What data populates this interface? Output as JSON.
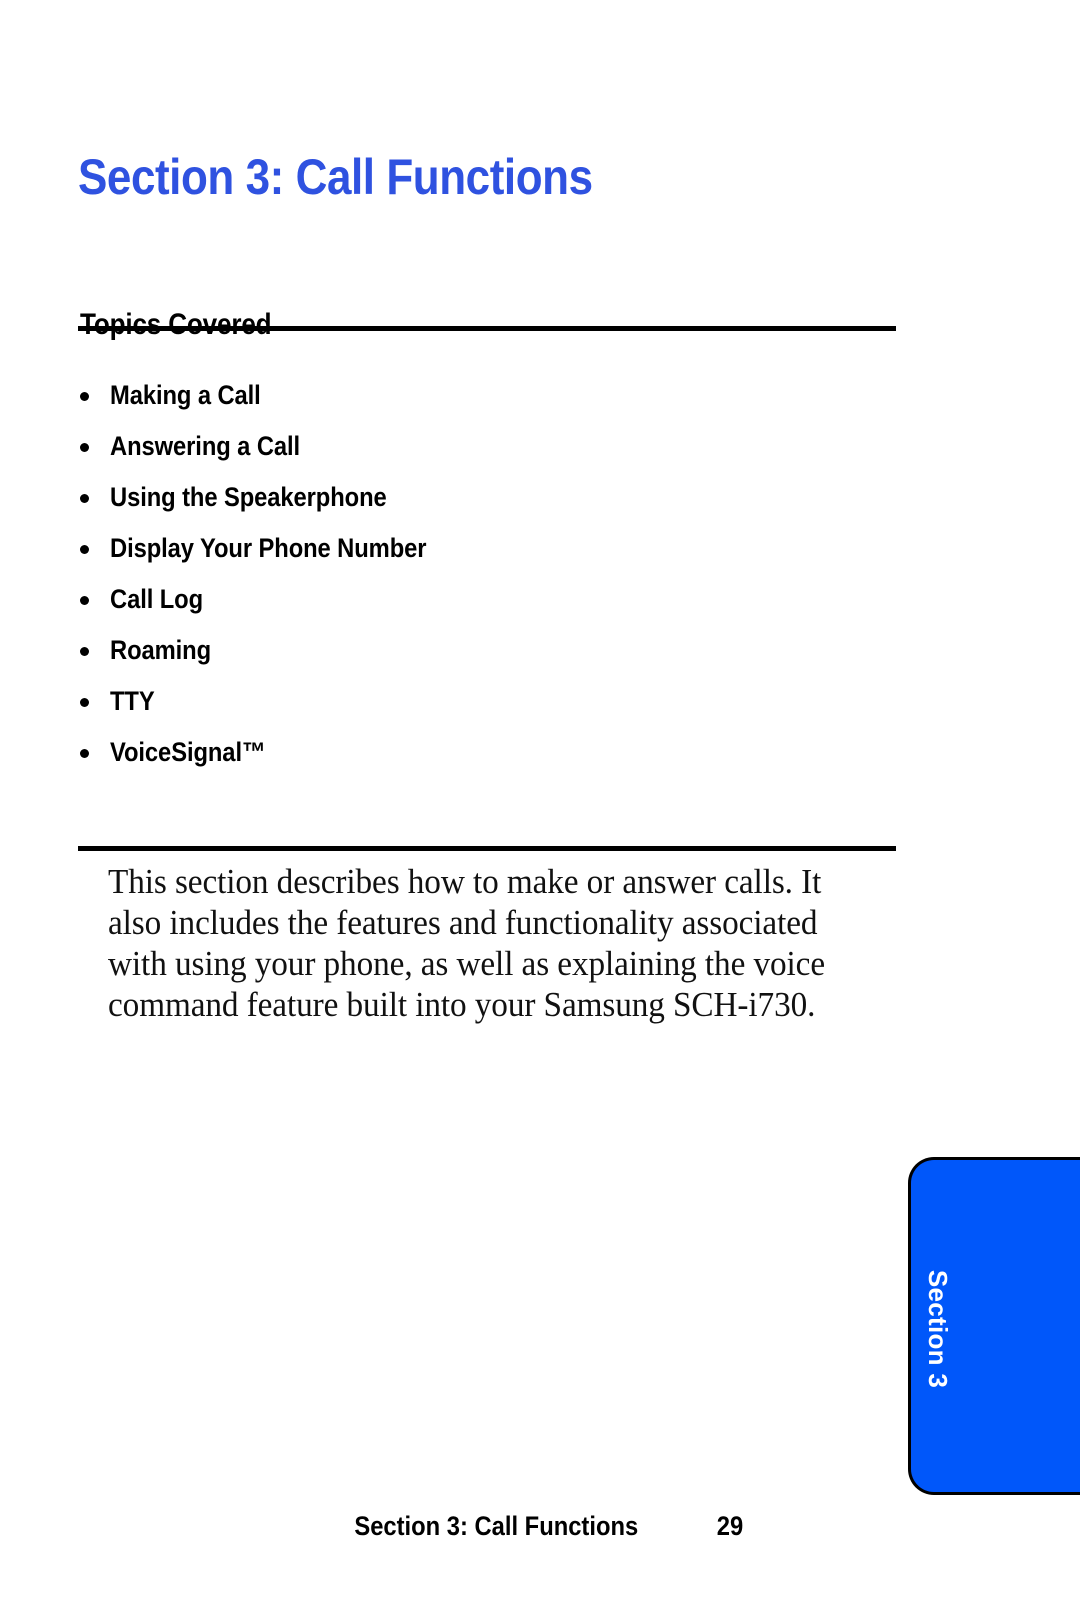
{
  "page": {
    "section_title": "Section 3: Call Functions",
    "topics_heading": "Topics Covered",
    "topics": [
      "Making a Call",
      "Answering a Call",
      "Using the Speakerphone",
      "Display Your Phone Number",
      "Call Log",
      "Roaming",
      "TTY",
      "VoiceSignal™"
    ],
    "intro_paragraph": "This section describes how to make or answer calls. It also includes the features and functionality associated with using your phone, as well as explaining the voice command feature built into your Samsung SCH-i730.",
    "side_tab_label": "Section 3",
    "footer": {
      "title": "Section 3: Call Functions",
      "page_number": "29"
    },
    "colors": {
      "title_blue": "#2F52E0",
      "tab_blue": "#0057FA",
      "text_black": "#000000",
      "tab_text": "#FFFFFF"
    }
  }
}
